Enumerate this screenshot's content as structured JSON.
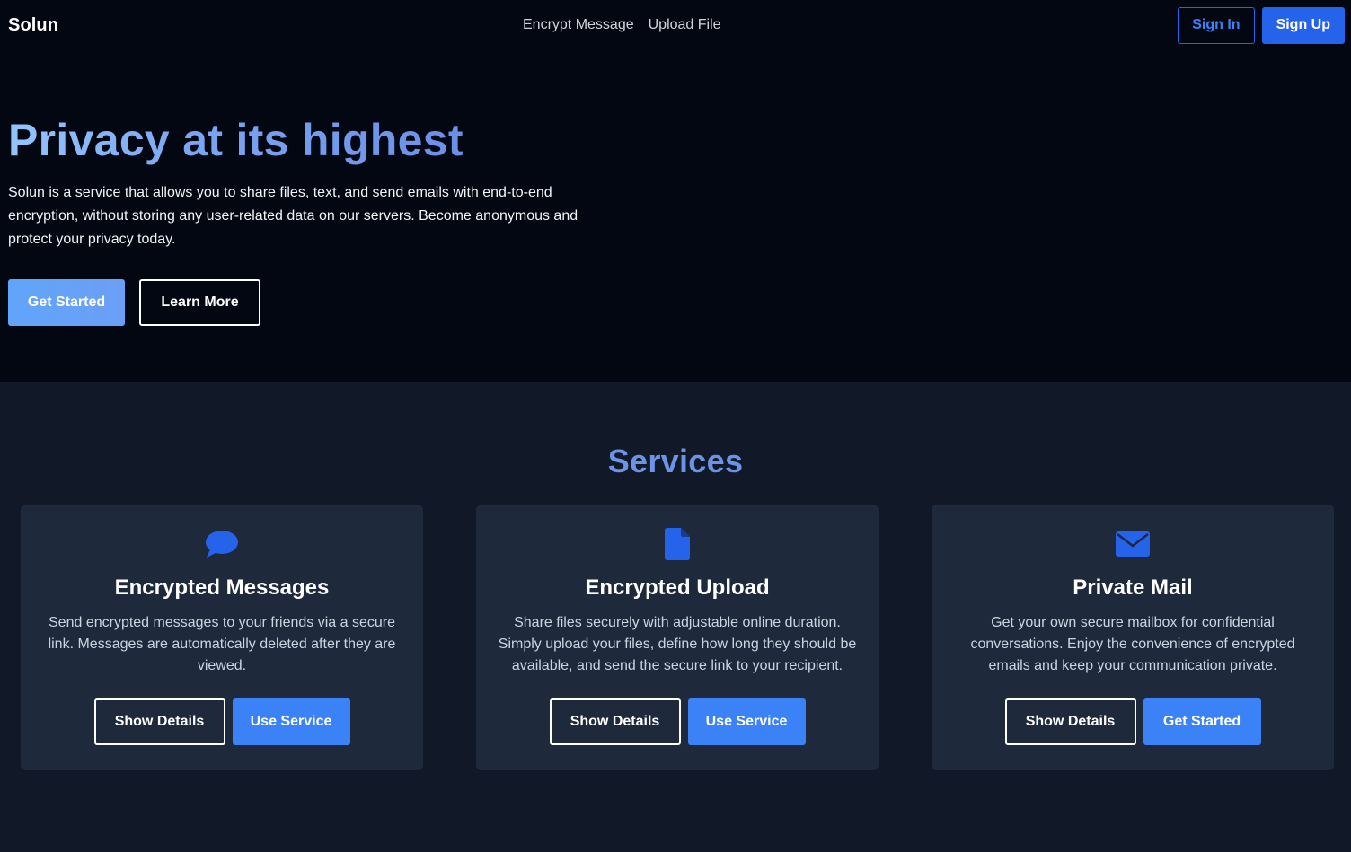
{
  "nav": {
    "brand": "Solun",
    "links": [
      "Encrypt Message",
      "Upload File"
    ],
    "sign_in": "Sign In",
    "sign_up": "Sign Up"
  },
  "hero": {
    "title": "Privacy at its highest",
    "description": "Solun is a service that allows you to share files, text, and send emails with end-to-end encryption, without storing any user-related data on our servers. Become anonymous and protect your privacy today.",
    "primary_button": "Get Started",
    "secondary_button": "Learn More"
  },
  "services": {
    "title": "Services",
    "cards": [
      {
        "icon": "chat-bubble-icon",
        "title": "Encrypted Messages",
        "description": "Send encrypted messages to your friends via a secure link. Messages are automatically deleted after they are viewed.",
        "details_button": "Show Details",
        "action_button": "Use Service"
      },
      {
        "icon": "file-icon",
        "title": "Encrypted Upload",
        "description": "Share files securely with adjustable online duration. Simply upload your files, define how long they should be available, and send the secure link to your recipient.",
        "details_button": "Show Details",
        "action_button": "Use Service"
      },
      {
        "icon": "envelope-icon",
        "title": "Private Mail",
        "description": "Get your own secure mailbox for confidential conversations. Enjoy the convenience of encrypted emails and keep your communication private.",
        "details_button": "Show Details",
        "action_button": "Get Started"
      }
    ]
  },
  "colors": {
    "hero_background": "#030712",
    "page_background": "#111827",
    "card_background": "#1e293b",
    "accent_blue": "#2563eb",
    "icon_blue": "#2563eb",
    "services_title": "#6b93e6"
  }
}
